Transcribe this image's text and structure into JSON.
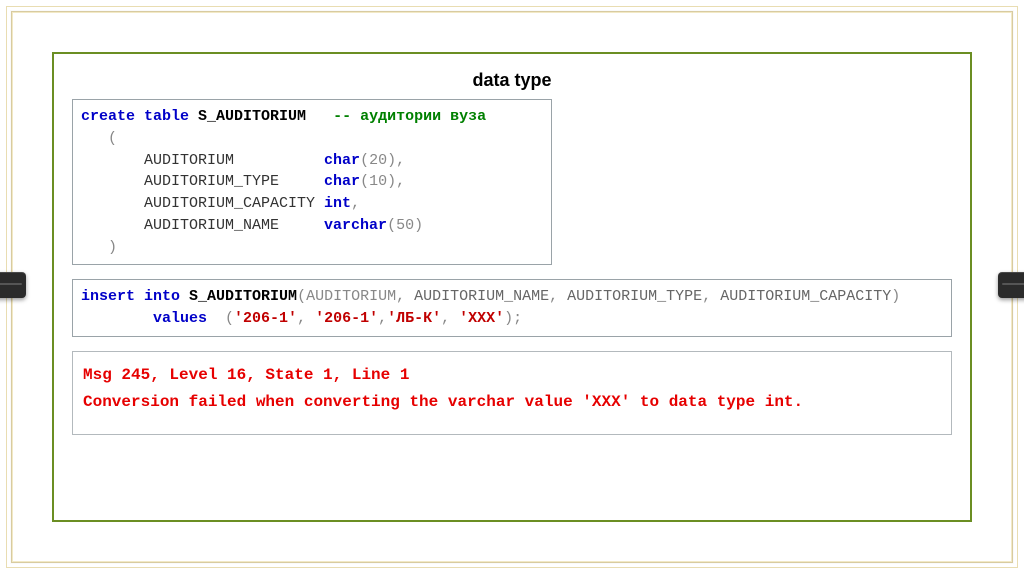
{
  "title": "data type",
  "code1": {
    "l1_a": "create table",
    "l1_b": " S_AUDITORIUM   ",
    "l1_c": "-- аудитории вуза",
    "l2": "   (",
    "l3_a": "       AUDITORIUM          ",
    "l3_b": "char",
    "l3_c": "(20)",
    "l3_d": ",",
    "l4_a": "       AUDITORIUM_TYPE     ",
    "l4_b": "char",
    "l4_c": "(10)",
    "l4_d": ",",
    "l5_a": "       AUDITORIUM_CAPACITY ",
    "l5_b": "int",
    "l5_c": ",",
    "l6_a": "       AUDITORIUM_NAME     ",
    "l6_b": "varchar",
    "l6_c": "(50)",
    "l7": "   )"
  },
  "code2": {
    "l1_a": "insert into",
    "l1_b": " S_AUDITORIUM",
    "l1_c": "(AUDITORIUM",
    "l1_d": ", ",
    "l1_e": "AUDITORIUM_NAME",
    "l1_f": ", ",
    "l1_g": "AUDITORIUM_TYPE",
    "l1_h": ", ",
    "l1_i": "AUDITORIUM_CAPACITY",
    "l1_j": ")",
    "l2_a": "        values  ",
    "l2_b": "(",
    "l2_c": "'206-1'",
    "l2_d": ", ",
    "l2_e": "'206-1'",
    "l2_f": ",",
    "l2_g": "'ЛБ-К'",
    "l2_h": ", ",
    "l2_i": "'XXX'",
    "l2_j": ");"
  },
  "error": {
    "l1": "Msg 245, Level 16, State 1, Line 1",
    "l2": "Conversion failed when converting the varchar value 'XXX' to data type int."
  }
}
